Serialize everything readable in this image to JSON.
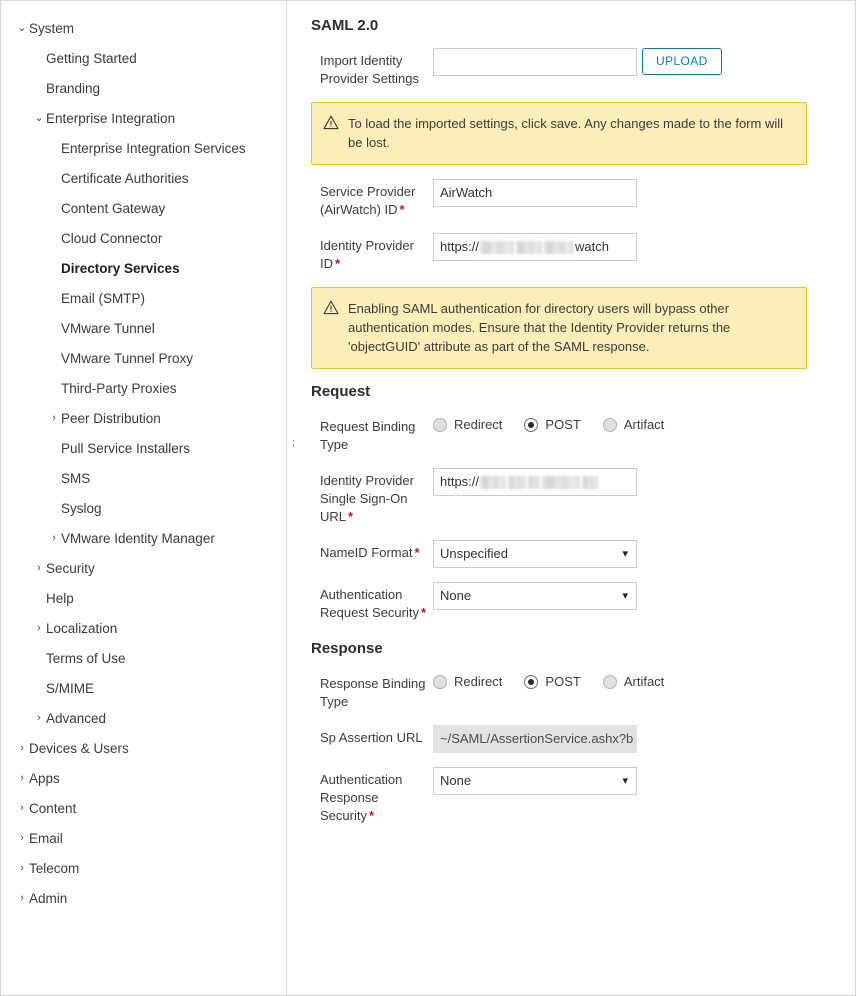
{
  "sidebar": {
    "items": [
      {
        "label": "System",
        "level": 0,
        "chevron": "down",
        "bold": false
      },
      {
        "label": "Getting Started",
        "level": 1,
        "chevron": "none",
        "bold": false
      },
      {
        "label": "Branding",
        "level": 1,
        "chevron": "none",
        "bold": false
      },
      {
        "label": "Enterprise Integration",
        "level": 1,
        "chevron": "down",
        "bold": false
      },
      {
        "label": "Enterprise Integration Services",
        "level": 2,
        "chevron": "none",
        "bold": false
      },
      {
        "label": "Certificate Authorities",
        "level": 2,
        "chevron": "none",
        "bold": false
      },
      {
        "label": "Content Gateway",
        "level": 2,
        "chevron": "none",
        "bold": false
      },
      {
        "label": "Cloud Connector",
        "level": 2,
        "chevron": "none",
        "bold": false
      },
      {
        "label": "Directory Services",
        "level": 2,
        "chevron": "none",
        "bold": true
      },
      {
        "label": "Email (SMTP)",
        "level": 2,
        "chevron": "none",
        "bold": false
      },
      {
        "label": "VMware Tunnel",
        "level": 2,
        "chevron": "none",
        "bold": false
      },
      {
        "label": "VMware Tunnel Proxy",
        "level": 2,
        "chevron": "none",
        "bold": false
      },
      {
        "label": "Third-Party Proxies",
        "level": 2,
        "chevron": "none",
        "bold": false
      },
      {
        "label": "Peer Distribution",
        "level": 2,
        "chevron": "right",
        "bold": false
      },
      {
        "label": "Pull Service Installers",
        "level": 2,
        "chevron": "none",
        "bold": false
      },
      {
        "label": "SMS",
        "level": 2,
        "chevron": "none",
        "bold": false
      },
      {
        "label": "Syslog",
        "level": 2,
        "chevron": "none",
        "bold": false
      },
      {
        "label": "VMware Identity Manager",
        "level": 2,
        "chevron": "right",
        "bold": false
      },
      {
        "label": "Security",
        "level": 1,
        "chevron": "right",
        "bold": false
      },
      {
        "label": "Help",
        "level": 1,
        "chevron": "none",
        "bold": false
      },
      {
        "label": "Localization",
        "level": 1,
        "chevron": "right",
        "bold": false
      },
      {
        "label": "Terms of Use",
        "level": 1,
        "chevron": "none",
        "bold": false
      },
      {
        "label": "S/MIME",
        "level": 1,
        "chevron": "none",
        "bold": false
      },
      {
        "label": "Advanced",
        "level": 1,
        "chevron": "right",
        "bold": false
      },
      {
        "label": "Devices & Users",
        "level": 0,
        "chevron": "right",
        "bold": false
      },
      {
        "label": "Apps",
        "level": 0,
        "chevron": "right",
        "bold": false
      },
      {
        "label": "Content",
        "level": 0,
        "chevron": "right",
        "bold": false
      },
      {
        "label": "Email",
        "level": 0,
        "chevron": "right",
        "bold": false
      },
      {
        "label": "Telecom",
        "level": 0,
        "chevron": "right",
        "bold": false
      },
      {
        "label": "Admin",
        "level": 0,
        "chevron": "right",
        "bold": false
      }
    ]
  },
  "main": {
    "title": "SAML 2.0",
    "stray_mark": ";",
    "import": {
      "label": "Import Identity Provider Settings",
      "value": "",
      "placeholder": "",
      "upload_label": "UPLOAD"
    },
    "alert_import": "To load the imported settings, click save. Any changes made to the form will be lost.",
    "service_provider": {
      "label": "Service Provider (AirWatch) ID",
      "required": "*",
      "value": "AirWatch"
    },
    "identity_provider_id": {
      "label": "Identity Provider ID",
      "required": "*",
      "prefix": "https://",
      "suffix": "watch"
    },
    "alert_saml": "Enabling SAML authentication for directory users will bypass other authentication modes. Ensure that the Identity Provider returns the 'objectGUID' attribute as part of the SAML response.",
    "request": {
      "heading": "Request",
      "binding_type": {
        "label": "Request Binding Type",
        "options": [
          "Redirect",
          "POST",
          "Artifact"
        ],
        "selected": "POST"
      },
      "sso_url": {
        "label": "Identity Provider Single Sign-On URL",
        "required": "*",
        "prefix": "https://",
        "suffix": ""
      },
      "nameid_format": {
        "label": "NameID Format",
        "required": "*",
        "value": "Unspecified"
      },
      "auth_request_security": {
        "label": "Authentication Request Security",
        "required": "*",
        "value": "None"
      }
    },
    "response": {
      "heading": "Response",
      "binding_type": {
        "label": "Response Binding Type",
        "options": [
          "Redirect",
          "POST",
          "Artifact"
        ],
        "selected": "POST"
      },
      "sp_assertion_url": {
        "label": "Sp Assertion URL",
        "value": "~/SAML/AssertionService.ashx?b"
      },
      "auth_response_security": {
        "label": "Authentication Response Security",
        "required": "*",
        "value": "None"
      }
    }
  },
  "colors": {
    "accent": "#0f7ba3",
    "alert_bg": "#fbeeb8",
    "alert_border": "#e8c81e",
    "required": "#b81b1b"
  }
}
